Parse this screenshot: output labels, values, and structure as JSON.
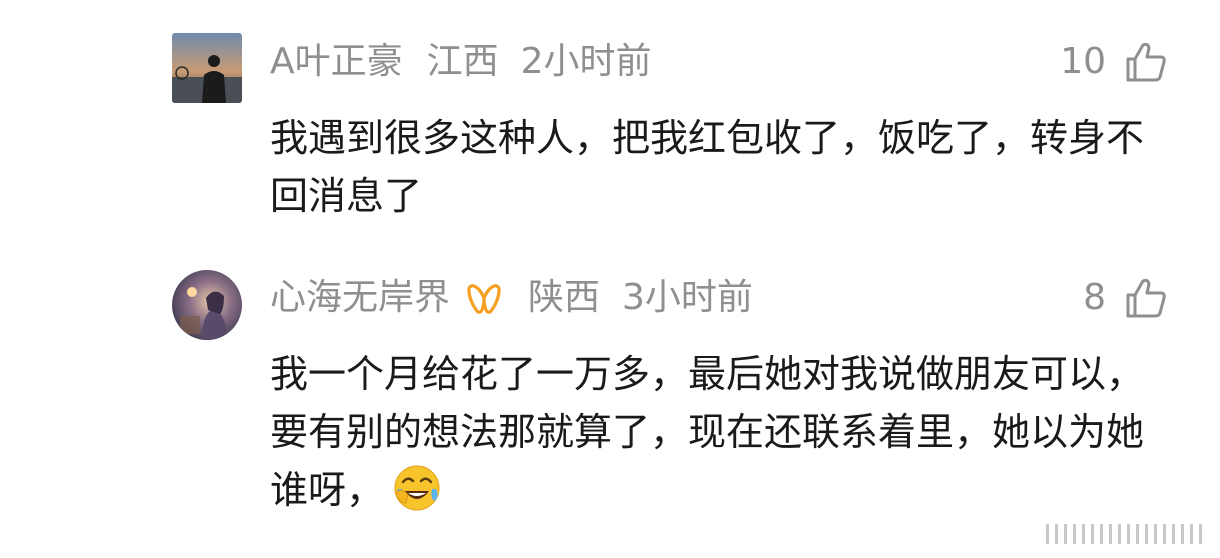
{
  "comments": [
    {
      "avatar": "avatar-photo-person-at-sunset",
      "username": "A叶正豪",
      "location": "江西",
      "time": "2小时前",
      "likes": "10",
      "text": "我遇到很多这种人，把我红包收了，饭吃了，转身不回消息了"
    },
    {
      "avatar": "avatar-illustration-girl-with-lantern",
      "username": "心海无岸界",
      "badge": "orange-ribbon-badge-icon",
      "location": "陕西",
      "time": "3小时前",
      "likes": "8",
      "text": "我一个月给花了一万多，最后她对我说做朋友可以，要有别的想法那就算了，现在还联系着里，她以为她谁呀，",
      "emoji": "crying-laughing-emoji"
    }
  ],
  "colors": {
    "meta": "#8f8f8f",
    "text": "#1a1a1a",
    "badge": "#f5a020",
    "emoji_face": "#f7c42c"
  }
}
